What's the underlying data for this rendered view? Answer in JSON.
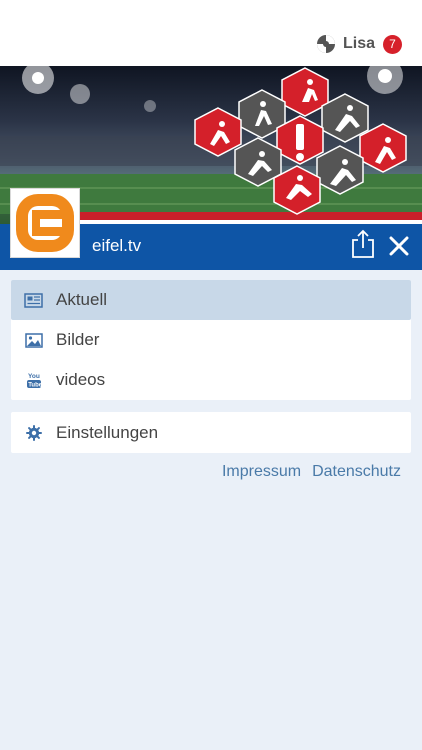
{
  "header": {
    "user_name": "Lisa",
    "badge_count": "7",
    "user_icon": "spinner-icon"
  },
  "brand": {
    "title": "eifel.tv",
    "logo_icon": "eifel-e-logo",
    "share_icon": "share-icon",
    "close_icon": "close-icon",
    "color": "#0e55a6"
  },
  "menu": {
    "items": [
      {
        "label": "Aktuell",
        "icon": "newspaper-icon",
        "active": true
      },
      {
        "label": "Bilder",
        "icon": "image-icon",
        "active": false
      },
      {
        "label": "videos",
        "icon": "youtube-icon",
        "active": false
      }
    ],
    "settings": {
      "label": "Einstellungen",
      "icon": "gear-icon"
    }
  },
  "footer": {
    "impressum": "Impressum",
    "datenschutz": "Datenschutz"
  },
  "colors": {
    "badge": "#d6202a",
    "hexagon_red": "#d4202a",
    "hexagon_gray": "#555555",
    "link": "#4a7aa8",
    "active_item": "#c8d8e8"
  }
}
